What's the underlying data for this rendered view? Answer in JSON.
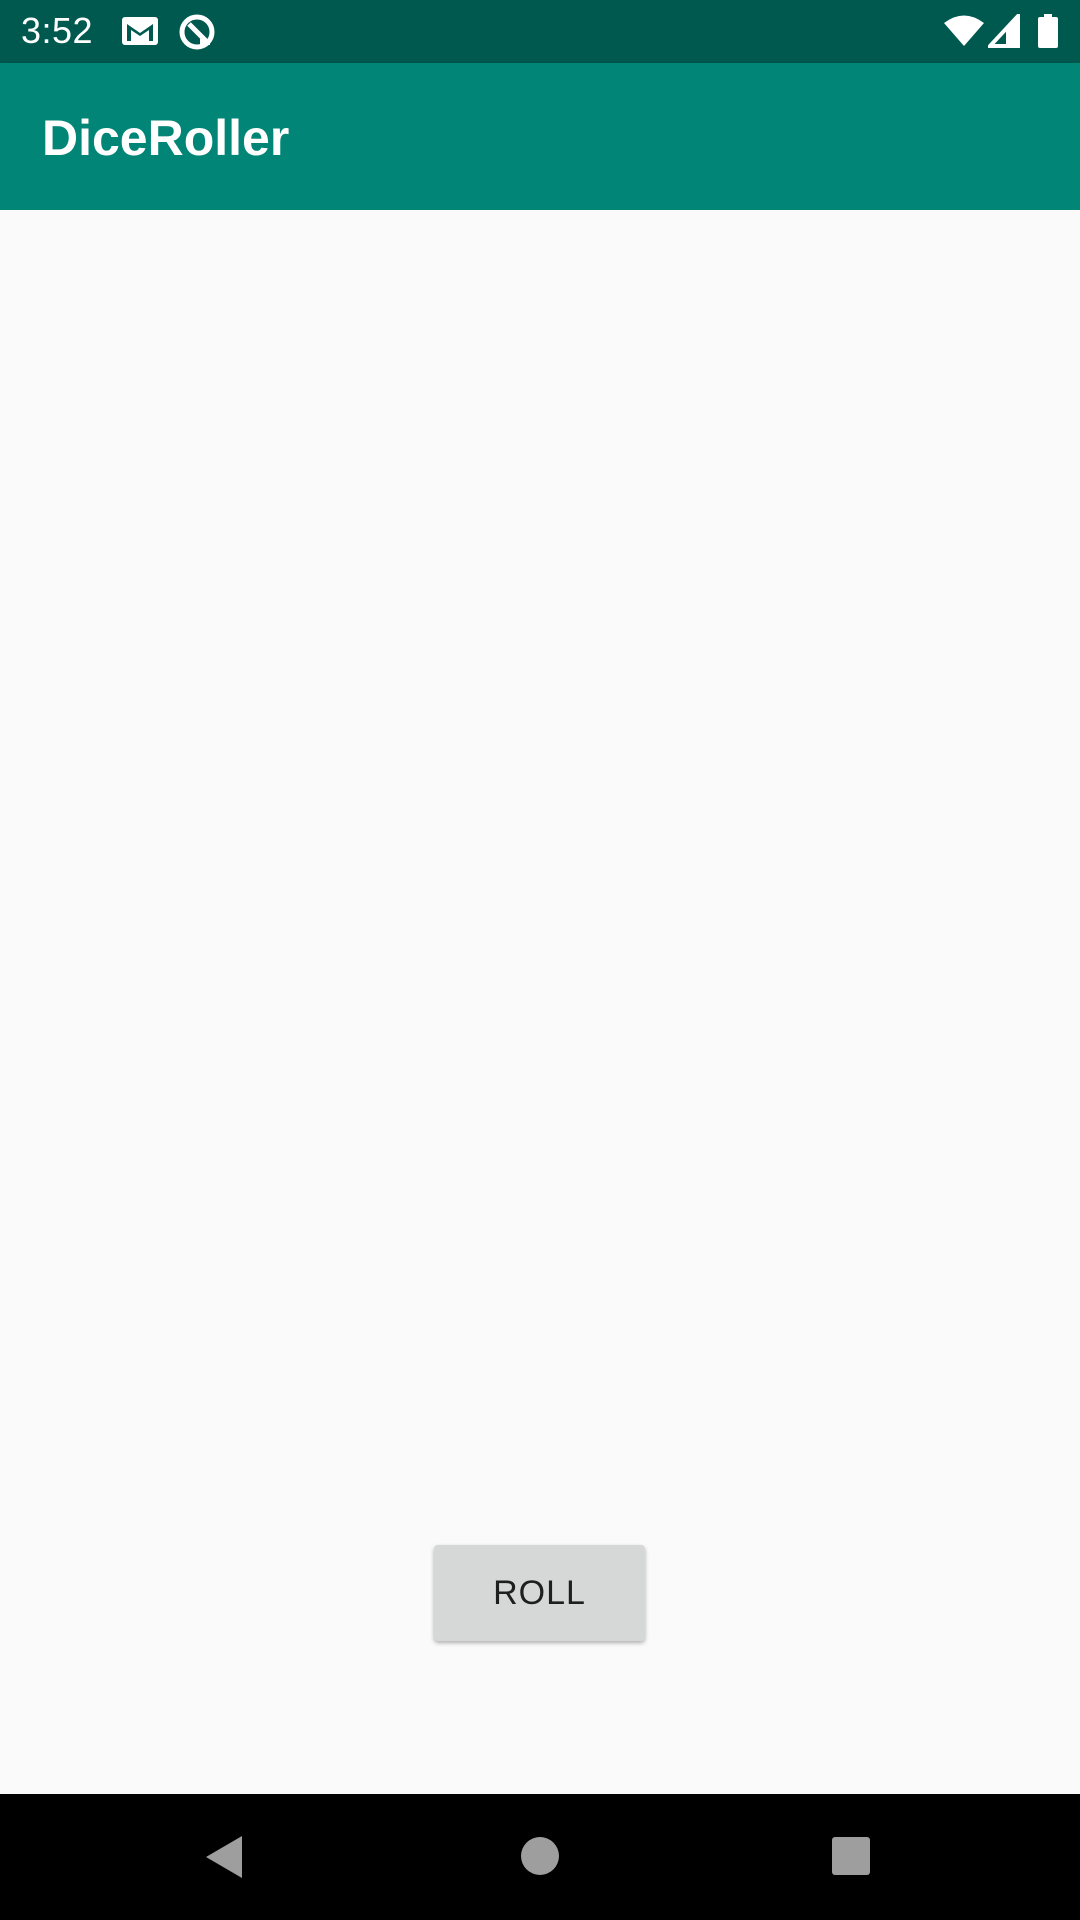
{
  "status_bar": {
    "time": "3:52",
    "icons": [
      "gmail-icon",
      "vpn-icon",
      "wifi-icon",
      "signal-icon",
      "battery-icon"
    ],
    "background": "#00594f"
  },
  "app_bar": {
    "title": "DiceRoller",
    "background": "#008577"
  },
  "main": {
    "roll_button_label": "ROLL",
    "background": "#fafafa"
  },
  "nav_bar": {
    "buttons": [
      "back-icon",
      "home-icon",
      "recents-icon"
    ],
    "background": "#000000"
  }
}
